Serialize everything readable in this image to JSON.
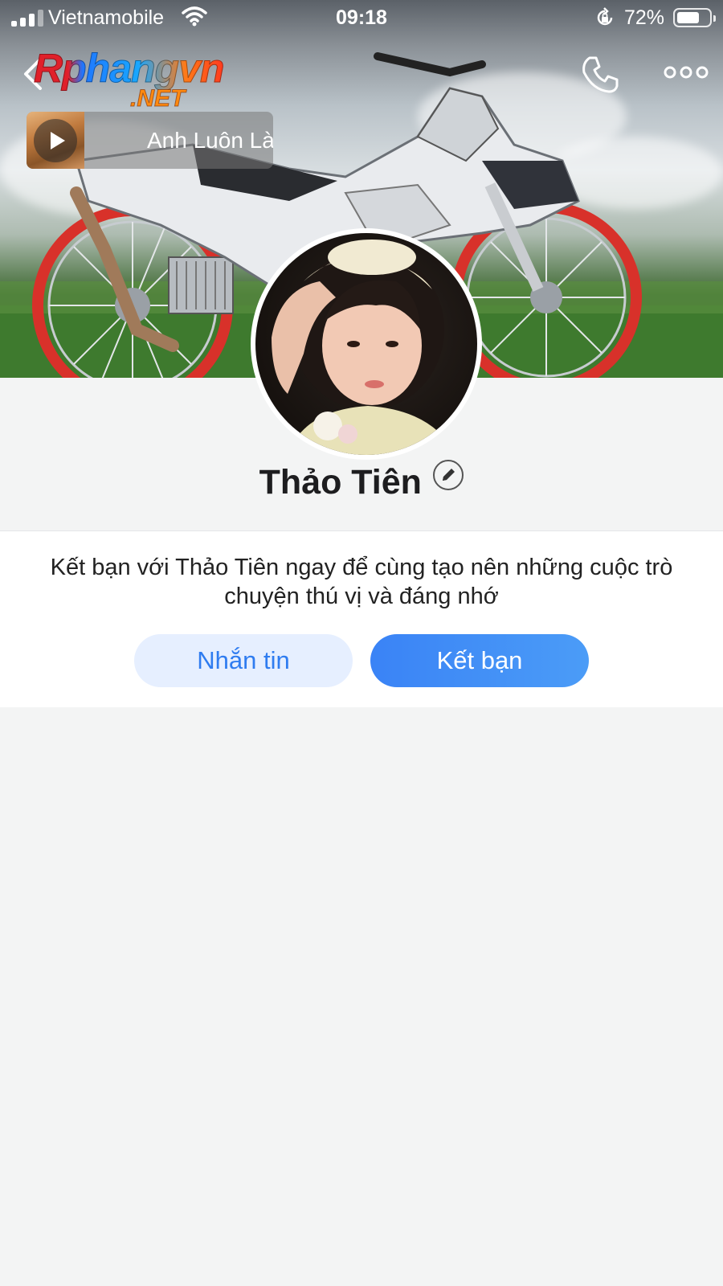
{
  "status_bar": {
    "carrier": "Vietnamobile",
    "time": "09:18",
    "battery_percent": "72%",
    "battery_level": 0.72
  },
  "header": {
    "watermark_main": "Rphangvn",
    "watermark_sub": ".NET",
    "icons": [
      "back-chevron-icon",
      "phone-icon",
      "more-dots-icon"
    ]
  },
  "music": {
    "title": "Anh Luôn Là"
  },
  "profile": {
    "name": "Thảo Tiên"
  },
  "friend_card": {
    "prompt": "Kết bạn với Thảo Tiên ngay để cùng tạo nên những cuộc trò chuyện thú vị và đáng nhớ",
    "message_button": "Nhắn tin",
    "add_friend_button": "Kết bạn"
  },
  "colors": {
    "accent": "#3a83f6",
    "message_button_bg": "#e6efff",
    "page_bg": "#f3f4f4"
  }
}
